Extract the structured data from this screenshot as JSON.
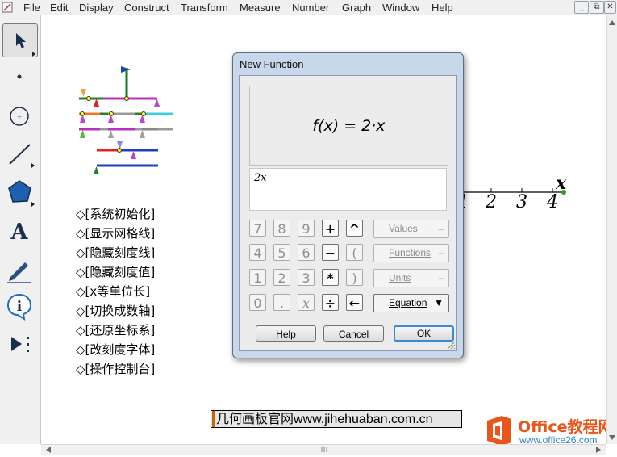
{
  "menubar": {
    "items": [
      "File",
      "Edit",
      "Display",
      "Construct",
      "Transform",
      "Measure",
      "Number",
      "Graph",
      "Window",
      "Help"
    ],
    "window_buttons": [
      "_",
      "⧉",
      "✕"
    ]
  },
  "toolbox": {
    "tools": [
      "arrow-tool-icon",
      "point-tool-icon",
      "compass-tool-icon",
      "straightedge-tool-icon",
      "polygon-tool-icon",
      "text-tool-icon",
      "marker-tool-icon",
      "information-tool-icon",
      "custom-tool-icon"
    ],
    "text_tool_glyph": "A",
    "info_glyph": "i"
  },
  "canvas": {
    "action_buttons": [
      "◇[系统初始化]",
      "◇[显示网格线]",
      "◇[隐藏刻度线]",
      "◇[隐藏刻度值]",
      "◇[x等单位长]",
      "◇[切换成数轴]",
      "◇[还原坐标系]",
      "◇[改刻度字体]",
      "◇[操作控制台]"
    ],
    "axis": {
      "tick_labels": [
        "1",
        "2",
        "3",
        "4"
      ],
      "axis_label": "x"
    },
    "watermark_site": "几何画板官网www.jihehuaban.com.cn",
    "office_logo": {
      "brand": "Office教程网",
      "url": "www.office26.com"
    }
  },
  "dialog": {
    "title": "New Function",
    "preview": "f(x) = 2·x",
    "expression": "2x",
    "keypad": [
      [
        "7",
        "8",
        "9",
        "+",
        "^"
      ],
      [
        "4",
        "5",
        "6",
        "−",
        "("
      ],
      [
        "1",
        "2",
        "3",
        "*",
        ")"
      ],
      [
        "0",
        ".",
        "x",
        "÷",
        "←"
      ]
    ],
    "side_buttons": [
      "Values",
      "Functions",
      "Units",
      "Equation"
    ],
    "buttons": {
      "help": "Help",
      "cancel": "Cancel",
      "ok": "OK"
    }
  },
  "colors": {
    "dialog_frame": "#c8d8ea",
    "ok_border": "#3b8ad8",
    "office_orange": "#e8561b",
    "office_blue": "#2f7fd1"
  }
}
